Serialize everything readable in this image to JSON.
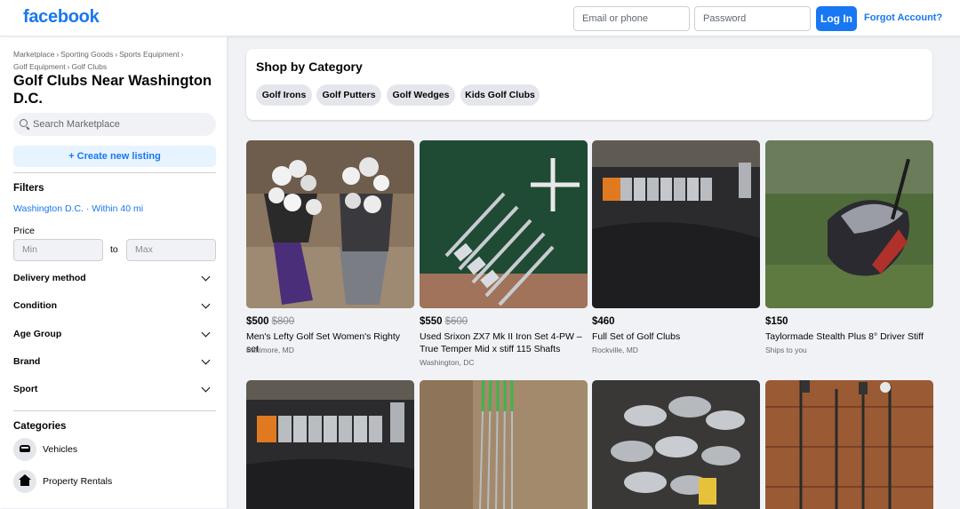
{
  "header": {
    "logo": "facebook",
    "email_placeholder": "Email or phone",
    "password_placeholder": "Password",
    "login_label": "Log In",
    "forgot_label": "Forgot Account?"
  },
  "sidebar": {
    "breadcrumb": [
      "Marketplace",
      "Sporting Goods",
      "Sports Equipment",
      "Golf Equipment",
      "Golf Clubs"
    ],
    "title": "Golf Clubs Near Washington D.C.",
    "search_placeholder": "Search Marketplace",
    "create_label": "+ Create new listing",
    "filters_title": "Filters",
    "location": "Washington D.C. · Within 40 mi",
    "price_label": "Price",
    "price_min_placeholder": "Min",
    "price_to": "to",
    "price_max_placeholder": "Max",
    "filters": [
      "Delivery method",
      "Condition",
      "Age Group",
      "Brand",
      "Sport"
    ],
    "categories_title": "Categories",
    "categories": [
      {
        "label": "Vehicles",
        "icon": "car-icon"
      },
      {
        "label": "Property Rentals",
        "icon": "house-icon"
      }
    ]
  },
  "shop_by_category": {
    "title": "Shop by Category",
    "chips": [
      "Golf Irons",
      "Golf Putters",
      "Golf Wedges",
      "Kids Golf Clubs"
    ]
  },
  "listings": [
    {
      "price": "$500",
      "old_price": "$800",
      "title": "Men's Lefty Golf Set Women's Righty set",
      "location": "Baltimore, MD"
    },
    {
      "price": "$550",
      "old_price": "$600",
      "title": "Used Srixon ZX7 Mk II Iron Set 4-PW – True Temper Mid x stiff 115 Shafts",
      "location": "Washington, DC"
    },
    {
      "price": "$460",
      "old_price": "",
      "title": "Full Set of Golf Clubs",
      "location": "Rockville, MD"
    },
    {
      "price": "$150",
      "old_price": "",
      "title": "Taylormade Stealth Plus 8° Driver Stiff",
      "location": "Ships to you"
    }
  ],
  "colors": {
    "brand": "#1877f2",
    "page_bg": "#f0f2f5",
    "chip_bg": "#e4e6eb"
  }
}
